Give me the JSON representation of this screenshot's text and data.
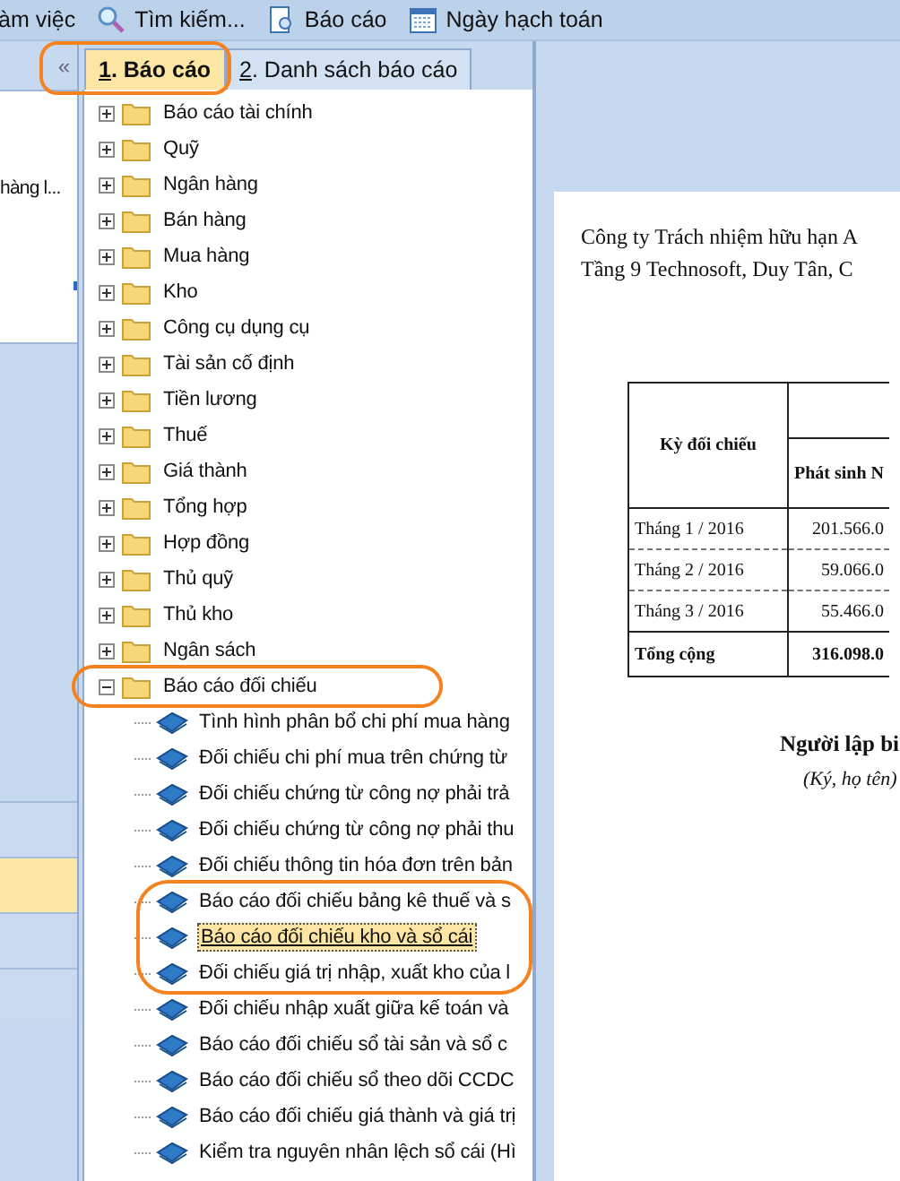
{
  "toolbar": [
    {
      "label": "àm việc",
      "kind": "plain"
    },
    {
      "label": "Tìm kiếm...",
      "kind": "search"
    },
    {
      "label": "Báo cáo",
      "kind": "report"
    },
    {
      "label": "Ngày hạch toán",
      "kind": "calendar"
    }
  ],
  "left_pane": {
    "collapse_button": "«",
    "item_text": "hàng l...",
    "rows": [
      {
        "selected": false
      },
      {
        "selected": true
      },
      {
        "selected": false
      },
      {
        "selected": false
      }
    ]
  },
  "tabs": [
    {
      "key": "1",
      "label": ". Báo cáo",
      "selected": true
    },
    {
      "key": "2",
      "label": ". Danh sách báo cáo",
      "selected": false
    }
  ],
  "tree": [
    {
      "label": "Báo cáo tài chính",
      "expanded": false
    },
    {
      "label": "Quỹ",
      "expanded": false
    },
    {
      "label": "Ngân hàng",
      "expanded": false
    },
    {
      "label": "Bán hàng",
      "expanded": false
    },
    {
      "label": "Mua hàng",
      "expanded": false
    },
    {
      "label": "Kho",
      "expanded": false
    },
    {
      "label": "Công cụ dụng cụ",
      "expanded": false
    },
    {
      "label": "Tài sản cố định",
      "expanded": false
    },
    {
      "label": "Tiền lương",
      "expanded": false
    },
    {
      "label": "Thuế",
      "expanded": false
    },
    {
      "label": "Giá thành",
      "expanded": false
    },
    {
      "label": "Tổng hợp",
      "expanded": false
    },
    {
      "label": "Hợp đồng",
      "expanded": false
    },
    {
      "label": "Thủ quỹ",
      "expanded": false
    },
    {
      "label": "Thủ kho",
      "expanded": false
    },
    {
      "label": "Ngân sách",
      "expanded": false
    },
    {
      "label": "Báo cáo đối chiếu",
      "expanded": true,
      "children": [
        {
          "label": "Tình hình phân bổ chi phí mua hàng",
          "selected": false
        },
        {
          "label": "Đối chiếu chi phí mua trên chứng từ",
          "selected": false
        },
        {
          "label": "Đối chiếu chứng từ công nợ phải trả",
          "selected": false
        },
        {
          "label": "Đối chiếu chứng từ công nợ phải thu",
          "selected": false
        },
        {
          "label": "Đối chiếu thông tin hóa đơn trên bản",
          "selected": false
        },
        {
          "label": "Báo cáo đối chiếu bảng kê thuế và s",
          "selected": false
        },
        {
          "label": "Báo cáo đối chiếu kho và sổ cái",
          "selected": true
        },
        {
          "label": "Đối chiếu giá trị nhập, xuất kho của l",
          "selected": false
        },
        {
          "label": "Đối chiếu nhập xuất giữa kế toán và",
          "selected": false
        },
        {
          "label": "Báo cáo đối chiếu sổ tài sản và sổ c",
          "selected": false
        },
        {
          "label": "Báo cáo đối chiếu sổ theo dõi CCDC",
          "selected": false
        },
        {
          "label": "Báo cáo đối chiếu giá thành và giá trị",
          "selected": false
        },
        {
          "label": "Kiểm tra nguyên nhân lệch sổ cái (Hì",
          "selected": false
        }
      ]
    }
  ],
  "report": {
    "company": [
      "Công ty Trách nhiệm hữu hạn A",
      "Tầng 9 Technosoft, Duy Tân, C"
    ],
    "table": {
      "columns": [
        "Kỳ đối chiếu",
        "Phát sinh N"
      ],
      "rows": [
        [
          "Tháng 1 / 2016",
          "201.566.0"
        ],
        [
          "Tháng 2 / 2016",
          "59.066.0"
        ],
        [
          "Tháng 3 / 2016",
          "55.466.0"
        ]
      ],
      "total": [
        "Tổng cộng",
        "316.098.0"
      ]
    },
    "signer": "Người lập bi",
    "signer_note": "(Ký, họ tên)"
  }
}
